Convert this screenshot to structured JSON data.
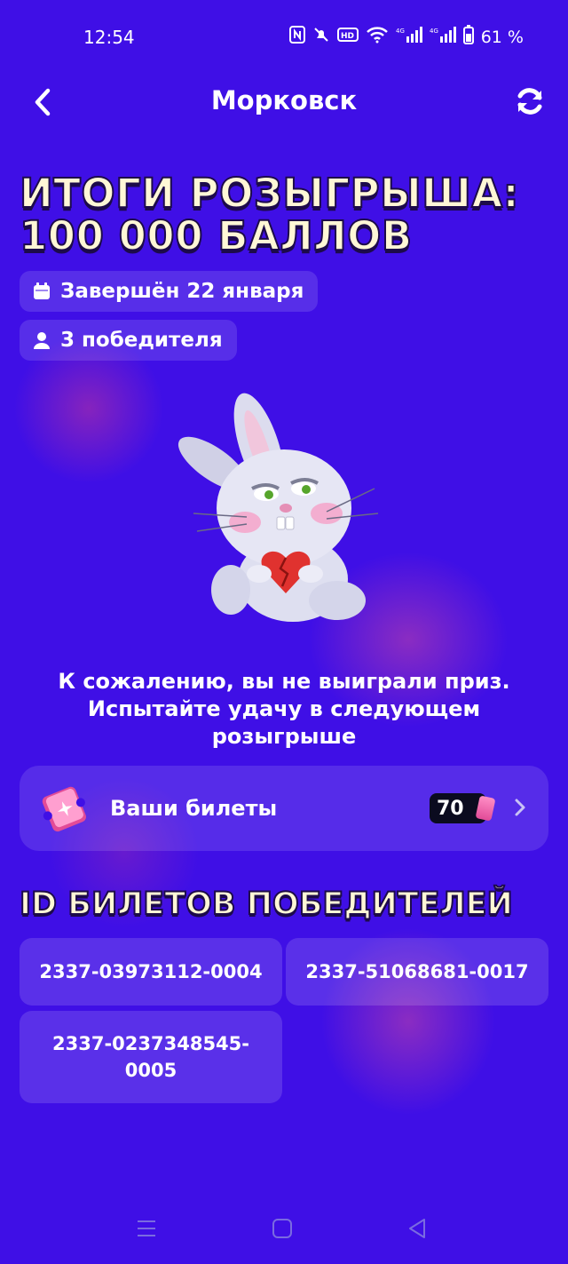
{
  "status_bar": {
    "time": "12:54",
    "battery": "61 %"
  },
  "nav": {
    "title": "Морковск"
  },
  "headline": {
    "line1": "ИТОГИ РОЗЫГРЫША:",
    "line2": "100 000 БАЛЛОВ"
  },
  "chips": {
    "date": "Завершён 22 января",
    "winners": "3 победителя"
  },
  "message": {
    "line1": "К сожалению, вы не выиграли приз.",
    "line2": "Испытайте удачу в следующем",
    "line3": "розыгрыше"
  },
  "tickets": {
    "label": "Ваши билеты",
    "count": "70"
  },
  "winners_section": {
    "title": "ID БИЛЕТОВ ПОБЕДИТЕЛЕЙ",
    "ids": [
      "2337-03973112-0004",
      "2337-51068681-0017",
      "2337-0237348545-0005"
    ]
  },
  "colors": {
    "background": "#3f0fe6",
    "headline": "#fff7d6",
    "headline_outline": "#1d0b4a",
    "ticket_pink": "#e24b97"
  }
}
